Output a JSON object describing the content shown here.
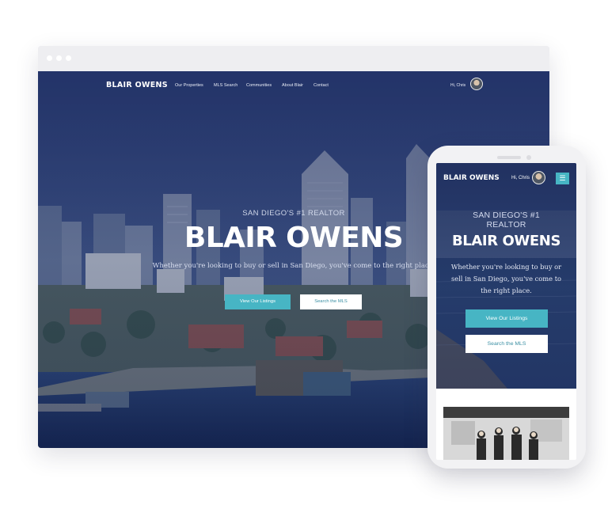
{
  "desktop": {
    "nav": {
      "logo": "BLAIR OWENS",
      "links": [
        "Our Properties",
        "MLS Search",
        "Communities",
        "About Blair",
        "Contact"
      ],
      "greeting": "Hi, Chris"
    },
    "hero": {
      "subtitle": "SAN DIEGO'S #1 REALTOR",
      "title": "BLAIR OWENS",
      "tagline": "Whether you're looking to buy or sell in San Diego, you've come to the right place.",
      "primary_button": "View Our Listings",
      "secondary_button": "Search the MLS"
    }
  },
  "mobile": {
    "logo": "BLAIR OWENS",
    "greeting": "Hi, Chris",
    "menu_icon": "☰",
    "hero": {
      "subtitle_line1": "SAN DIEGO'S #1",
      "subtitle_line2": "REALTOR",
      "title": "BLAIR OWENS",
      "tagline": "Whether you're looking to buy or sell in San Diego, you've come to the right place.",
      "primary_button": "View Our Listings",
      "secondary_button": "Search the MLS"
    }
  },
  "icons": [
    "window-dot-icon",
    "avatar",
    "hamburger-menu-icon"
  ],
  "colors": {
    "accent": "#47b5c4",
    "overlay": "#1c2a5c",
    "button_text_secondary": "#3a8fa3"
  }
}
